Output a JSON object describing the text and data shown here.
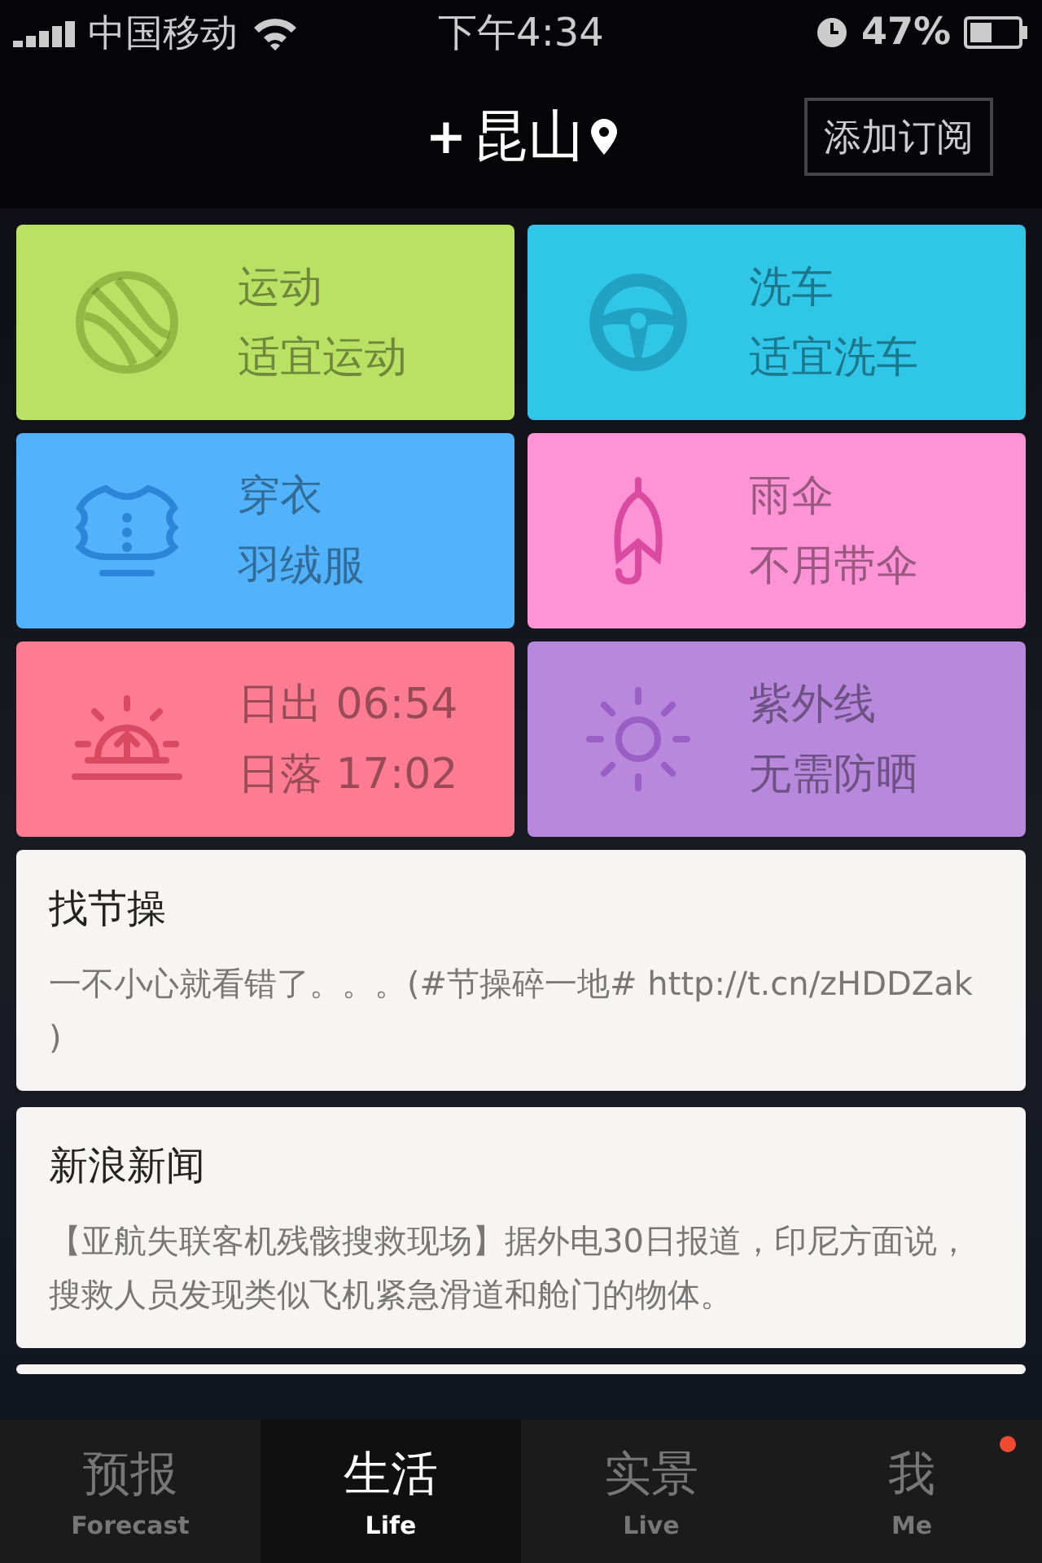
{
  "status_bar": {
    "carrier": "中国移动",
    "time": "下午4:34",
    "battery": "47%"
  },
  "header": {
    "plus": "+",
    "city": "昆山",
    "subscribe_button": "添加订阅"
  },
  "tiles": [
    {
      "kind": "ball",
      "color": "#b9e264",
      "line1": "运动",
      "line2": "适宜运动"
    },
    {
      "kind": "wheel",
      "color": "#30c6e8",
      "line1": "洗车",
      "line2": "适宜洗车"
    },
    {
      "kind": "coat",
      "color": "#52b2fc",
      "line1": "穿衣",
      "line2": "羽绒服"
    },
    {
      "kind": "umbrella",
      "color": "#fe93d6",
      "line1": "雨伞",
      "line2": "不用带伞"
    },
    {
      "kind": "sunrise",
      "color": "#fd7c92",
      "line1": "日出 06:54",
      "line2": "日落 17:02"
    },
    {
      "kind": "sun",
      "color": "#b888dc",
      "line1": "紫外线",
      "line2": "无需防晒"
    }
  ],
  "cards": [
    {
      "title": "找节操",
      "body": "一不小心就看错了。。。(#节操碎一地# http://t.cn/zHDDZak )"
    },
    {
      "title": "新浪新闻",
      "body": "【亚航失联客机残骸搜救现场】据外电30日报道，印尼方面说，搜救人员发现类似飞机紧急滑道和舱门的物体。"
    }
  ],
  "tabs": [
    {
      "label": "预报",
      "sublabel": "Forecast",
      "selected": false,
      "badge": false
    },
    {
      "label": "生活",
      "sublabel": "Life",
      "selected": true,
      "badge": false
    },
    {
      "label": "实景",
      "sublabel": "Live",
      "selected": false,
      "badge": false
    },
    {
      "label": "我",
      "sublabel": "Me",
      "selected": false,
      "badge": true
    }
  ]
}
